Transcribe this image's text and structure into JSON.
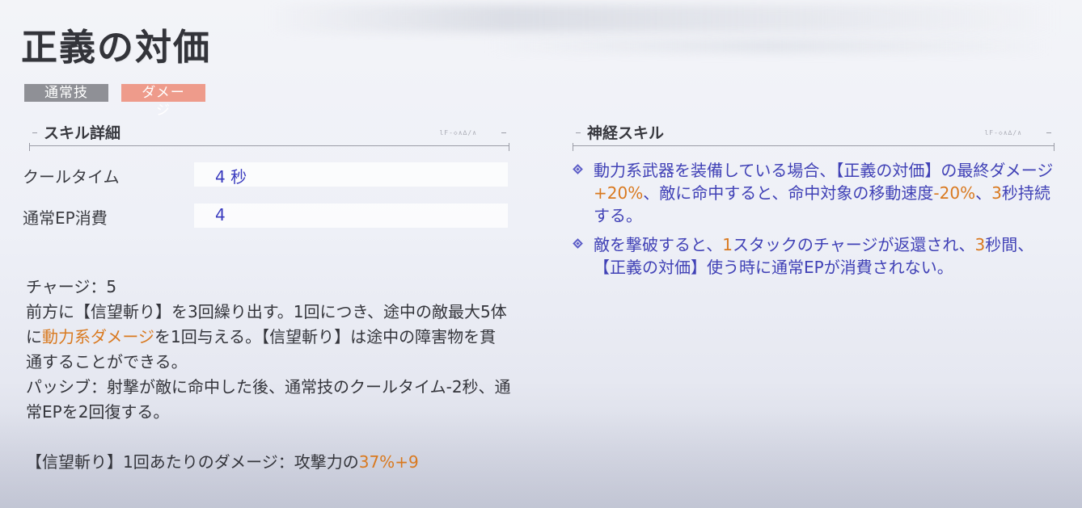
{
  "skill": {
    "title": "正義の対価",
    "tags": [
      "通常技",
      "ダメージ"
    ]
  },
  "detail": {
    "header": "スキル詳細",
    "deco": "lF-◇∧∆∕∧",
    "stats": [
      {
        "name": "クールタイム",
        "value": "4 秒"
      },
      {
        "name": "通常EP消費",
        "value": "4"
      }
    ],
    "description": {
      "line1": "チャージ：5",
      "line2a": "前方に【信望斬り】を3回繰り出す。1回につき、途中の敵最大5体に",
      "line2_highlight": "動力系ダメージ",
      "line2b": "を1回与える。【信望斬り】は途中の障害物を貫通することができる。",
      "line3": "パッシブ：射撃が敵に命中した後、通常技のクールタイム-2秒、通常EPを2回復する。",
      "formula_prefix": "【信望斬り】1回あたりのダメージ：攻撃力の",
      "formula_value": "37%+9"
    }
  },
  "neuro": {
    "header": "神経スキル",
    "deco": "lF-◇∧∆∕∧",
    "items": [
      {
        "p1": "動力系武器を装備している場合、【正義の対価】の最終ダメージ",
        "v1": "+20%",
        "p2": "、敵に命中すると、命中対象の移動速度",
        "v2": "-20%",
        "p3": "、",
        "v3": "3",
        "p4": "秒持続する。"
      },
      {
        "p1": "敵を撃破すると、",
        "v1": "1",
        "p2": "スタックのチャージが返還され、",
        "v2": "3",
        "p3": "秒間、【正義の対価】使う時に通常EPが消費されない。"
      }
    ]
  },
  "colors": {
    "accent_blue": "#3a3bbf",
    "highlight_orange": "#d9791f",
    "tag_normal": "#8f9096",
    "tag_damage": "#ee9b8b"
  }
}
